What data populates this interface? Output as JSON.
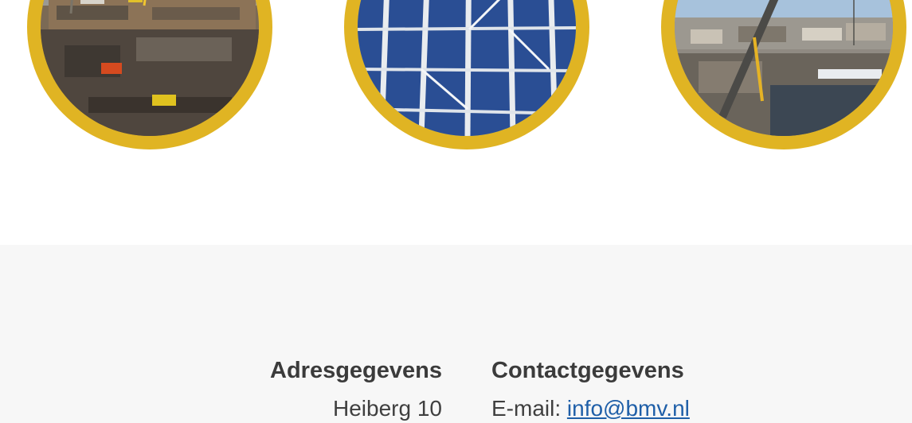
{
  "photos": [
    {
      "subject": "construction-site-excavation"
    },
    {
      "subject": "steel-frame-structure"
    },
    {
      "subject": "crane-over-city"
    }
  ],
  "colors": {
    "ring": "#e0b423",
    "footer_bg": "#f7f7f7",
    "link": "#1f5fa8",
    "text": "#3b3b3b"
  },
  "footer": {
    "address": {
      "heading": "Adresgegevens",
      "street": "Heiberg 10"
    },
    "contact": {
      "heading": "Contactgegevens",
      "email_label": "E-mail:",
      "email": "info@bmv.nl"
    }
  }
}
